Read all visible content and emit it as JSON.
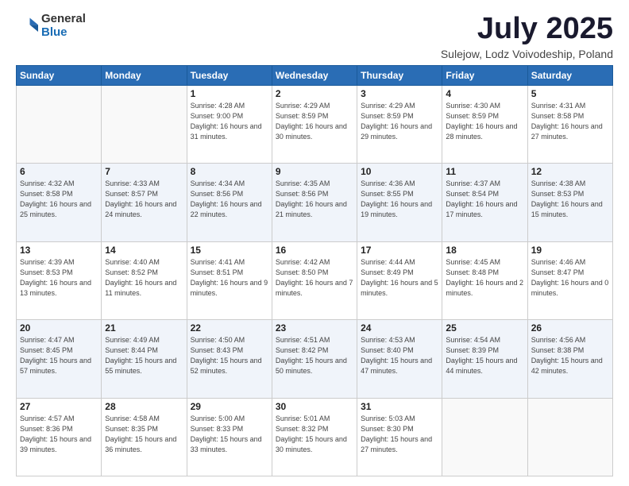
{
  "logo": {
    "general": "General",
    "blue": "Blue"
  },
  "title": {
    "month": "July 2025",
    "location": "Sulejow, Lodz Voivodeship, Poland"
  },
  "weekdays": [
    "Sunday",
    "Monday",
    "Tuesday",
    "Wednesday",
    "Thursday",
    "Friday",
    "Saturday"
  ],
  "weeks": [
    [
      {
        "day": "",
        "sunrise": "",
        "sunset": "",
        "daylight": ""
      },
      {
        "day": "",
        "sunrise": "",
        "sunset": "",
        "daylight": ""
      },
      {
        "day": "1",
        "sunrise": "Sunrise: 4:28 AM",
        "sunset": "Sunset: 9:00 PM",
        "daylight": "Daylight: 16 hours and 31 minutes."
      },
      {
        "day": "2",
        "sunrise": "Sunrise: 4:29 AM",
        "sunset": "Sunset: 8:59 PM",
        "daylight": "Daylight: 16 hours and 30 minutes."
      },
      {
        "day": "3",
        "sunrise": "Sunrise: 4:29 AM",
        "sunset": "Sunset: 8:59 PM",
        "daylight": "Daylight: 16 hours and 29 minutes."
      },
      {
        "day": "4",
        "sunrise": "Sunrise: 4:30 AM",
        "sunset": "Sunset: 8:59 PM",
        "daylight": "Daylight: 16 hours and 28 minutes."
      },
      {
        "day": "5",
        "sunrise": "Sunrise: 4:31 AM",
        "sunset": "Sunset: 8:58 PM",
        "daylight": "Daylight: 16 hours and 27 minutes."
      }
    ],
    [
      {
        "day": "6",
        "sunrise": "Sunrise: 4:32 AM",
        "sunset": "Sunset: 8:58 PM",
        "daylight": "Daylight: 16 hours and 25 minutes."
      },
      {
        "day": "7",
        "sunrise": "Sunrise: 4:33 AM",
        "sunset": "Sunset: 8:57 PM",
        "daylight": "Daylight: 16 hours and 24 minutes."
      },
      {
        "day": "8",
        "sunrise": "Sunrise: 4:34 AM",
        "sunset": "Sunset: 8:56 PM",
        "daylight": "Daylight: 16 hours and 22 minutes."
      },
      {
        "day": "9",
        "sunrise": "Sunrise: 4:35 AM",
        "sunset": "Sunset: 8:56 PM",
        "daylight": "Daylight: 16 hours and 21 minutes."
      },
      {
        "day": "10",
        "sunrise": "Sunrise: 4:36 AM",
        "sunset": "Sunset: 8:55 PM",
        "daylight": "Daylight: 16 hours and 19 minutes."
      },
      {
        "day": "11",
        "sunrise": "Sunrise: 4:37 AM",
        "sunset": "Sunset: 8:54 PM",
        "daylight": "Daylight: 16 hours and 17 minutes."
      },
      {
        "day": "12",
        "sunrise": "Sunrise: 4:38 AM",
        "sunset": "Sunset: 8:53 PM",
        "daylight": "Daylight: 16 hours and 15 minutes."
      }
    ],
    [
      {
        "day": "13",
        "sunrise": "Sunrise: 4:39 AM",
        "sunset": "Sunset: 8:53 PM",
        "daylight": "Daylight: 16 hours and 13 minutes."
      },
      {
        "day": "14",
        "sunrise": "Sunrise: 4:40 AM",
        "sunset": "Sunset: 8:52 PM",
        "daylight": "Daylight: 16 hours and 11 minutes."
      },
      {
        "day": "15",
        "sunrise": "Sunrise: 4:41 AM",
        "sunset": "Sunset: 8:51 PM",
        "daylight": "Daylight: 16 hours and 9 minutes."
      },
      {
        "day": "16",
        "sunrise": "Sunrise: 4:42 AM",
        "sunset": "Sunset: 8:50 PM",
        "daylight": "Daylight: 16 hours and 7 minutes."
      },
      {
        "day": "17",
        "sunrise": "Sunrise: 4:44 AM",
        "sunset": "Sunset: 8:49 PM",
        "daylight": "Daylight: 16 hours and 5 minutes."
      },
      {
        "day": "18",
        "sunrise": "Sunrise: 4:45 AM",
        "sunset": "Sunset: 8:48 PM",
        "daylight": "Daylight: 16 hours and 2 minutes."
      },
      {
        "day": "19",
        "sunrise": "Sunrise: 4:46 AM",
        "sunset": "Sunset: 8:47 PM",
        "daylight": "Daylight: 16 hours and 0 minutes."
      }
    ],
    [
      {
        "day": "20",
        "sunrise": "Sunrise: 4:47 AM",
        "sunset": "Sunset: 8:45 PM",
        "daylight": "Daylight: 15 hours and 57 minutes."
      },
      {
        "day": "21",
        "sunrise": "Sunrise: 4:49 AM",
        "sunset": "Sunset: 8:44 PM",
        "daylight": "Daylight: 15 hours and 55 minutes."
      },
      {
        "day": "22",
        "sunrise": "Sunrise: 4:50 AM",
        "sunset": "Sunset: 8:43 PM",
        "daylight": "Daylight: 15 hours and 52 minutes."
      },
      {
        "day": "23",
        "sunrise": "Sunrise: 4:51 AM",
        "sunset": "Sunset: 8:42 PM",
        "daylight": "Daylight: 15 hours and 50 minutes."
      },
      {
        "day": "24",
        "sunrise": "Sunrise: 4:53 AM",
        "sunset": "Sunset: 8:40 PM",
        "daylight": "Daylight: 15 hours and 47 minutes."
      },
      {
        "day": "25",
        "sunrise": "Sunrise: 4:54 AM",
        "sunset": "Sunset: 8:39 PM",
        "daylight": "Daylight: 15 hours and 44 minutes."
      },
      {
        "day": "26",
        "sunrise": "Sunrise: 4:56 AM",
        "sunset": "Sunset: 8:38 PM",
        "daylight": "Daylight: 15 hours and 42 minutes."
      }
    ],
    [
      {
        "day": "27",
        "sunrise": "Sunrise: 4:57 AM",
        "sunset": "Sunset: 8:36 PM",
        "daylight": "Daylight: 15 hours and 39 minutes."
      },
      {
        "day": "28",
        "sunrise": "Sunrise: 4:58 AM",
        "sunset": "Sunset: 8:35 PM",
        "daylight": "Daylight: 15 hours and 36 minutes."
      },
      {
        "day": "29",
        "sunrise": "Sunrise: 5:00 AM",
        "sunset": "Sunset: 8:33 PM",
        "daylight": "Daylight: 15 hours and 33 minutes."
      },
      {
        "day": "30",
        "sunrise": "Sunrise: 5:01 AM",
        "sunset": "Sunset: 8:32 PM",
        "daylight": "Daylight: 15 hours and 30 minutes."
      },
      {
        "day": "31",
        "sunrise": "Sunrise: 5:03 AM",
        "sunset": "Sunset: 8:30 PM",
        "daylight": "Daylight: 15 hours and 27 minutes."
      },
      {
        "day": "",
        "sunrise": "",
        "sunset": "",
        "daylight": ""
      },
      {
        "day": "",
        "sunrise": "",
        "sunset": "",
        "daylight": ""
      }
    ]
  ]
}
